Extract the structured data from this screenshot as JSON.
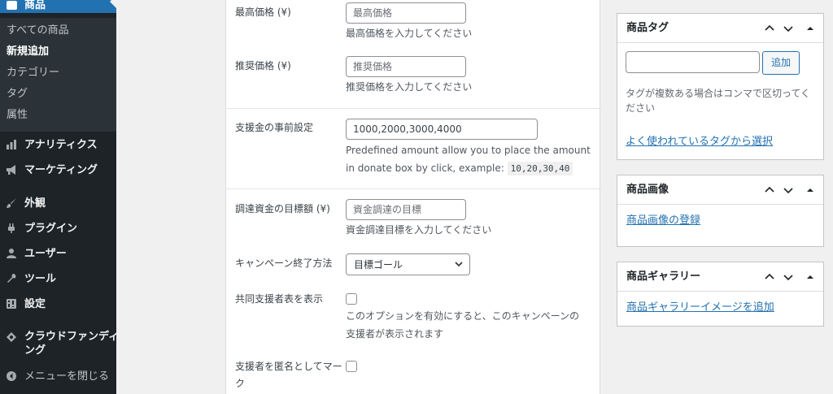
{
  "sidebar": {
    "active_label": "商品",
    "submenu": [
      {
        "label": "すべての商品"
      },
      {
        "label": "新規追加"
      },
      {
        "label": "カテゴリー"
      },
      {
        "label": "タグ"
      },
      {
        "label": "属性"
      }
    ],
    "menu": [
      {
        "label": "アナリティクス",
        "icon": "bar-chart-icon"
      },
      {
        "label": "マーケティング",
        "icon": "megaphone-icon"
      },
      {
        "label": "外観",
        "icon": "paintbrush-icon"
      },
      {
        "label": "プラグイン",
        "icon": "plugin-icon"
      },
      {
        "label": "ユーザー",
        "icon": "user-icon"
      },
      {
        "label": "ツール",
        "icon": "wrench-icon"
      },
      {
        "label": "設定",
        "icon": "settings-icon"
      },
      {
        "label_line1": "クラウドファンディ",
        "label_line2": "ング",
        "icon": "crowdfunding-icon"
      },
      {
        "label": "メニューを閉じる",
        "icon": "collapse-icon"
      }
    ]
  },
  "form": {
    "max_price": {
      "label": "最高価格 (¥)",
      "placeholder": "最高価格",
      "desc": "最高価格を入力してください"
    },
    "recommended_price": {
      "label": "推奨価格 (¥)",
      "placeholder": "推奨価格",
      "desc": "推奨価格を入力してください"
    },
    "preset_amounts": {
      "label": "支援金の事前設定",
      "value": "1000,2000,3000,4000",
      "desc_line1": "Predefined amount allow you to place the amount",
      "desc_line2": "in donate box by click, example:",
      "example_code": "10,20,30,40"
    },
    "goal": {
      "label": "調達資金の目標額 (¥)",
      "placeholder": "資金調達の目標",
      "desc": "資金調達目標を入力してください"
    },
    "end_method": {
      "label": "キャンペーン終了方法",
      "selected": "目標ゴール"
    },
    "show_backers": {
      "label": "共同支援者表を表示",
      "desc_line1": "このオプションを有効にすると、このキャンペーンの",
      "desc_line2": "支援者が表示されます"
    },
    "anonymous": {
      "label_line1": "支援者を匿名としてマー",
      "label_line2": "ク"
    }
  },
  "widgets": {
    "tags": {
      "title": "商品タグ",
      "add_button": "追加",
      "help": "タグが複数ある場合はコンマで区切ってください",
      "link": "よく使われているタグから選択"
    },
    "image": {
      "title": "商品画像",
      "link": "商品画像の登録"
    },
    "gallery": {
      "title": "商品ギャラリー",
      "link": "商品ギャラリーイメージを追加"
    }
  },
  "colors": {
    "sidebar_bg": "#1d2327",
    "accent": "#2271b1",
    "page_bg": "#f0f0f1"
  }
}
